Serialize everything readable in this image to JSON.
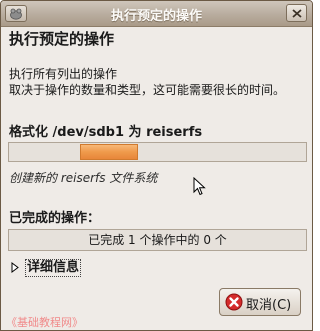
{
  "window": {
    "title": "执行预定的操作"
  },
  "content": {
    "heading": "执行预定的操作",
    "description_line1": "执行所有列出的操作",
    "description_line2": "取决于操作的数量和类型，这可能需要很长的时间。",
    "operation_title": "格式化 /dev/sdb1 为 reiserfs",
    "status_text": "创建新的 reiserfs 文件系统",
    "completed_label": "已完成的操作：",
    "completed_text": "已完成 1 个操作中的 0 个",
    "details_label": "详细信息"
  },
  "progress": {
    "mode": "pulsing (indeterminate)"
  },
  "buttons": {
    "cancel_label": "取消(C)"
  },
  "watermark": "《基础教程网》",
  "colors": {
    "accent": "#ef9a4b",
    "titlebar": "#b8ac9e",
    "window_bg": "#efebe7",
    "cancel_icon": "#d42b2b"
  },
  "icons": [
    "window-menu-icon",
    "close-icon",
    "mouse-cursor-icon",
    "expander-arrow-icon",
    "cancel-icon"
  ]
}
